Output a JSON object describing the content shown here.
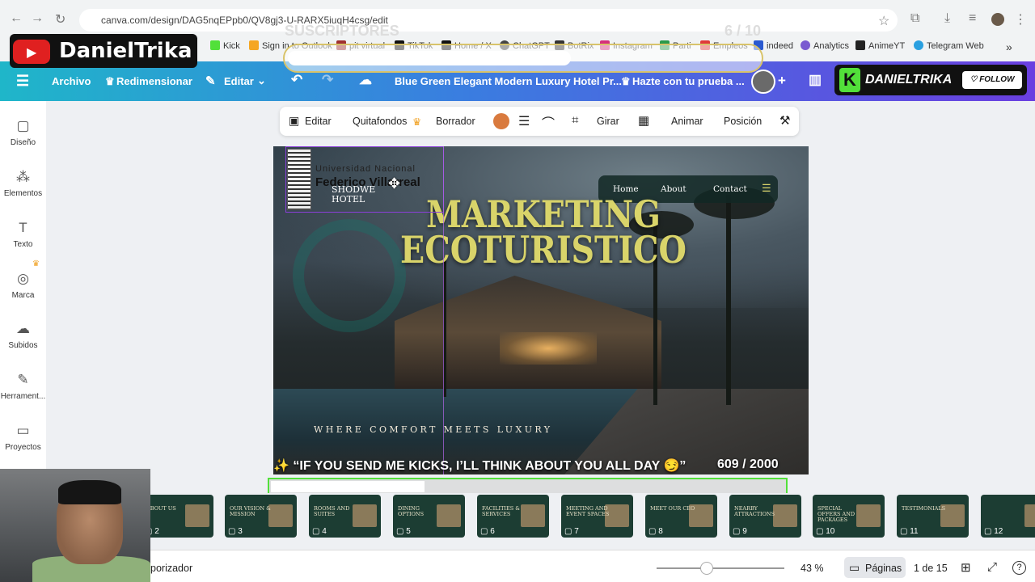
{
  "browser": {
    "url": "canva.com/design/DAG5nqEPpb0/QV8gj3-U-RARX5iuqH4csg/edit",
    "bookmarks": [
      "Kick",
      "Sign in to Outlook",
      "pit virtual",
      "TikTok",
      "Home / X",
      "ChatGPT",
      "BotRix",
      "Instagram",
      "Parti",
      "Empleos",
      "indeed",
      "Analytics",
      "AnimeYT",
      "Telegram Web"
    ]
  },
  "header": {
    "archivo": "Archivo",
    "redimensionar": "Redimensionar",
    "editar": "Editar",
    "doc_title": "Blue Green Elegant Modern Luxury Hotel Pr...",
    "promo": "Hazte con tu prueba ..."
  },
  "sidebar": [
    {
      "label": "Diseño",
      "icon": "layout-icon"
    },
    {
      "label": "Elementos",
      "icon": "shapes-icon"
    },
    {
      "label": "Texto",
      "icon": "text-icon"
    },
    {
      "label": "Marca",
      "icon": "brand-icon"
    },
    {
      "label": "Subidos",
      "icon": "upload-icon"
    },
    {
      "label": "Herrament...",
      "icon": "tools-icon"
    },
    {
      "label": "Proyectos",
      "icon": "folder-icon"
    }
  ],
  "toolbar": {
    "editar": "Editar",
    "quitafondos": "Quitafondos",
    "borrador": "Borrador",
    "girar": "Girar",
    "animar": "Animar",
    "posicion": "Posición",
    "color": "#d97a3e"
  },
  "slide": {
    "university_line1": "Universidad Nacional",
    "university_line2": "Federico Villarreal",
    "hotel_line1": "SHODWE",
    "hotel_line2": "HOTEL",
    "title1": "MARKETING",
    "title2": "ECOTURISTICO",
    "tagline": "WHERE COMFORT MEETS LUXURY",
    "nav": [
      "Home",
      "About",
      "Contact"
    ]
  },
  "overlays": {
    "channel": "DanielTrika",
    "subs_label": "SUSCRIPTORES",
    "subs_count": "6 / 10",
    "subs_progress": 0.6,
    "kick_name": "DANIELTRIKA",
    "follow": "FOLLOW",
    "kick_message": "✨ “IF YOU SEND ME KICKS, I’LL THINK ABOUT YOU ALL DAY 😏”",
    "kick_count": "609  / 2000",
    "kick_progress": 0.3045
  },
  "pages": [
    {
      "n": "2",
      "title": "ABOUT US"
    },
    {
      "n": "3",
      "title": "OUR VISION & MISSION"
    },
    {
      "n": "4",
      "title": "ROOMS AND SUITES"
    },
    {
      "n": "5",
      "title": "DINING OPTIONS"
    },
    {
      "n": "6",
      "title": "FACILITIES & SERVICES"
    },
    {
      "n": "7",
      "title": "MEETING AND EVENT SPACES"
    },
    {
      "n": "8",
      "title": "MEET OUR CEO"
    },
    {
      "n": "9",
      "title": "NEARBY ATTRACTIONS"
    },
    {
      "n": "10",
      "title": "SPECIAL OFFERS AND PACKAGES"
    },
    {
      "n": "11",
      "title": "TESTIMONIALS"
    },
    {
      "n": "12",
      "title": ""
    }
  ],
  "bottombar": {
    "temporizador": "porizador",
    "zoom": "43 %",
    "paginas": "Páginas",
    "page_count": "1 de 15"
  }
}
